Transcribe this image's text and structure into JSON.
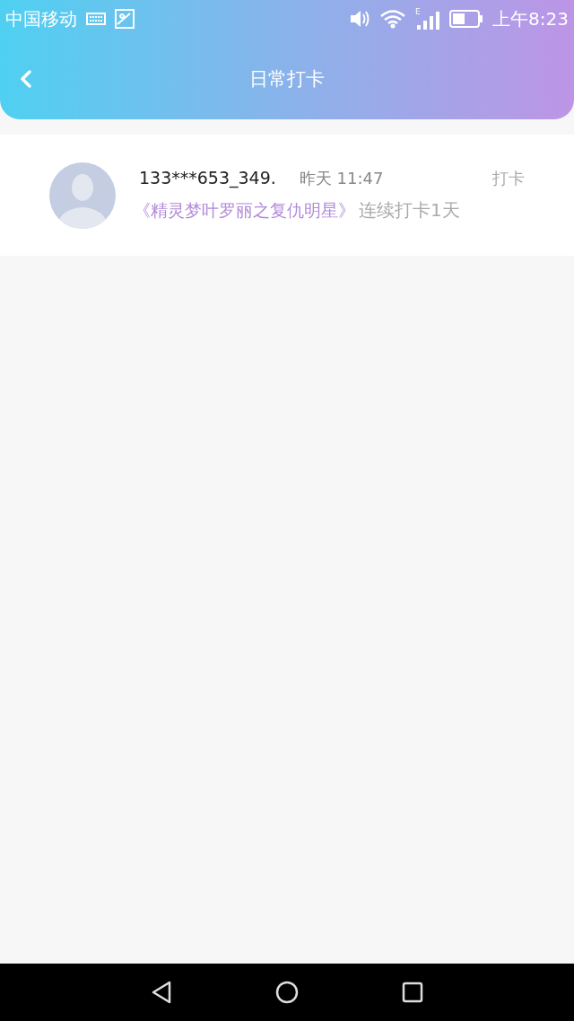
{
  "status_bar": {
    "carrier": "中国移动",
    "time": "上午8:23",
    "network": "E"
  },
  "header": {
    "title": "日常打卡"
  },
  "checkins": [
    {
      "user": "133***653_349.",
      "time": "昨天 11:47",
      "action": "打卡",
      "book": "《精灵梦叶罗丽之复仇明星》",
      "streak": "连续打卡1天"
    }
  ]
}
